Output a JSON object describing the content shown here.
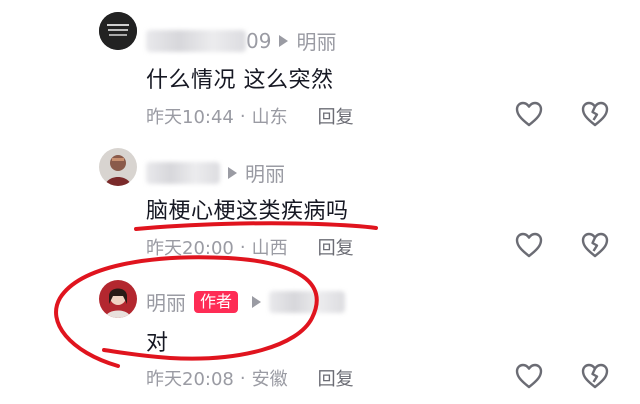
{
  "comments": [
    {
      "name_suffix": "09",
      "reply_to": "明丽",
      "text": "什么情况  这么突然",
      "time": "昨天10:44",
      "location": "山东",
      "reply_label": "回复"
    },
    {
      "reply_to": "明丽",
      "text": "脑梗心梗这类疾病吗",
      "time": "昨天20:00",
      "location": "山西",
      "reply_label": "回复"
    },
    {
      "author": "明丽",
      "author_badge": "作者",
      "text": "对",
      "time": "昨天20:08",
      "location": "安徽",
      "reply_label": "回复"
    }
  ],
  "separator": "·",
  "colors": {
    "accent_badge": "#fe2c55",
    "annotation_red": "#e0141e",
    "meta_gray": "#9a9ba3"
  }
}
